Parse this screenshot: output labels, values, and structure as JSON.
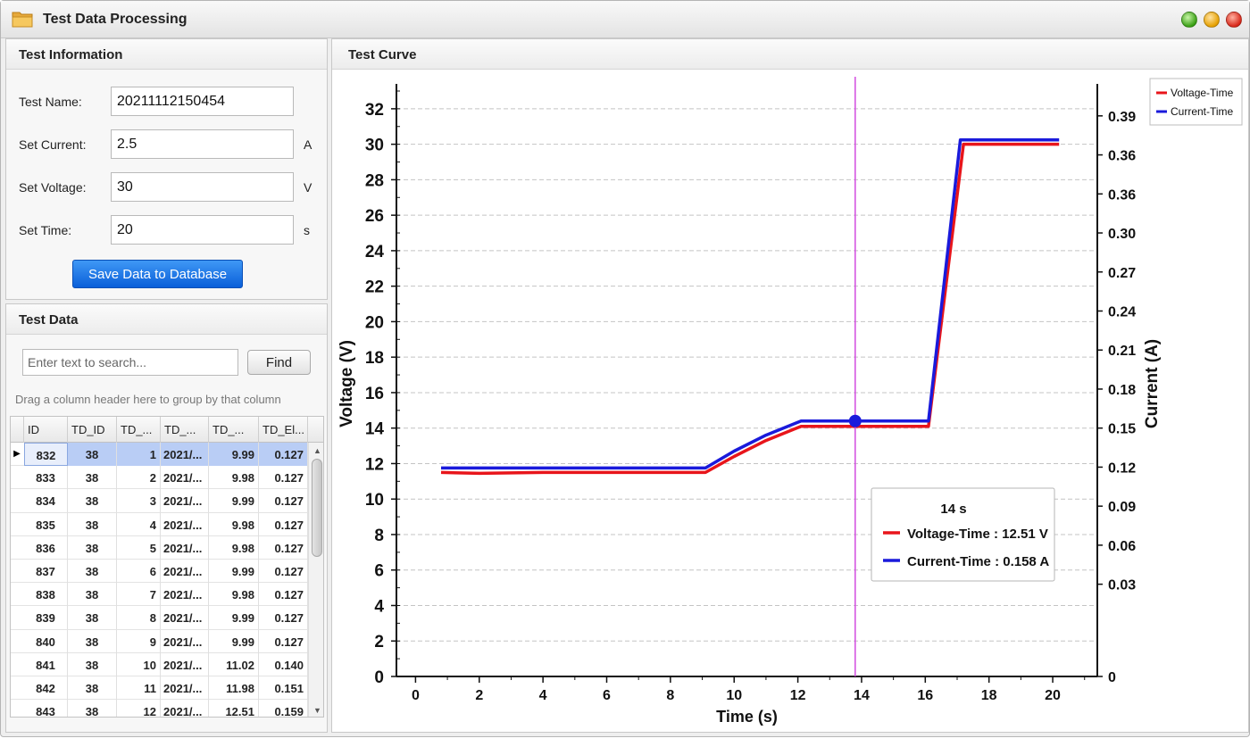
{
  "window": {
    "title": "Test Data Processing"
  },
  "info_panel": {
    "title": "Test Information",
    "fields": {
      "name": {
        "label": "Test Name:",
        "value": "20211112150454",
        "unit": ""
      },
      "current": {
        "label": "Set Current:",
        "value": "2.5",
        "unit": "A"
      },
      "voltage": {
        "label": "Set Voltage:",
        "value": "30",
        "unit": "V"
      },
      "time": {
        "label": "Set Time:",
        "value": "20",
        "unit": "s"
      }
    },
    "save_label": "Save Data to Database"
  },
  "data_panel": {
    "title": "Test Data",
    "search_placeholder": "Enter text to search...",
    "find_label": "Find",
    "group_hint": "Drag a column header here to group by that column",
    "columns": [
      "ID",
      "TD_ID",
      "TD_...",
      "TD_...",
      "TD_...",
      "TD_El..."
    ],
    "selected_indicator": "▶",
    "rows": [
      [
        "832",
        "38",
        "1",
        "2021/...",
        "9.99",
        "0.127"
      ],
      [
        "833",
        "38",
        "2",
        "2021/...",
        "9.98",
        "0.127"
      ],
      [
        "834",
        "38",
        "3",
        "2021/...",
        "9.99",
        "0.127"
      ],
      [
        "835",
        "38",
        "4",
        "2021/...",
        "9.98",
        "0.127"
      ],
      [
        "836",
        "38",
        "5",
        "2021/...",
        "9.98",
        "0.127"
      ],
      [
        "837",
        "38",
        "6",
        "2021/...",
        "9.99",
        "0.127"
      ],
      [
        "838",
        "38",
        "7",
        "2021/...",
        "9.98",
        "0.127"
      ],
      [
        "839",
        "38",
        "8",
        "2021/...",
        "9.99",
        "0.127"
      ],
      [
        "840",
        "38",
        "9",
        "2021/...",
        "9.99",
        "0.127"
      ],
      [
        "841",
        "38",
        "10",
        "2021/...",
        "11.02",
        "0.140"
      ],
      [
        "842",
        "38",
        "11",
        "2021/...",
        "11.98",
        "0.151"
      ],
      [
        "843",
        "38",
        "12",
        "2021/...",
        "12.51",
        "0.159"
      ]
    ]
  },
  "curve_panel": {
    "title": "Test Curve"
  },
  "chart_data": {
    "type": "line",
    "xlabel": "Time (s)",
    "ylabel": "Voltage (V)",
    "y2label": "Current (A)",
    "xlim": [
      -0.6,
      21.4
    ],
    "ylim": [
      0,
      33
    ],
    "x_ticks": [
      0,
      2,
      4,
      6,
      8,
      10,
      12,
      14,
      16,
      18,
      20
    ],
    "y_ticks": [
      0,
      2,
      4,
      6,
      8,
      10,
      12,
      14,
      16,
      18,
      20,
      22,
      24,
      26,
      28,
      30,
      32
    ],
    "y2_tick_labels": [
      {
        "label": "0",
        "at_voltage": 0
      },
      {
        "label": "0.03",
        "at_voltage": 5.2
      },
      {
        "label": "0.06",
        "at_voltage": 7.4
      },
      {
        "label": "0.09",
        "at_voltage": 9.6
      },
      {
        "label": "0.12",
        "at_voltage": 11.8
      },
      {
        "label": "0.15",
        "at_voltage": 14.0
      },
      {
        "label": "0.18",
        "at_voltage": 16.2
      },
      {
        "label": "0.21",
        "at_voltage": 18.4
      },
      {
        "label": "0.24",
        "at_voltage": 20.6
      },
      {
        "label": "0.27",
        "at_voltage": 22.8
      },
      {
        "label": "0.30",
        "at_voltage": 25.0
      },
      {
        "label": "0.36",
        "at_voltage": 27.2
      },
      {
        "label": "0.36",
        "at_voltage": 29.4
      },
      {
        "label": "0.39",
        "at_voltage": 31.6
      }
    ],
    "grid": true,
    "legend_position": "top-right",
    "series": [
      {
        "name": "Voltage-Time",
        "color": "#e8151b",
        "x": [
          0.8,
          2,
          4,
          6,
          8,
          9.1,
          10,
          11,
          12.1,
          14,
          16.1,
          17.2,
          20.2
        ],
        "y": [
          11.5,
          11.45,
          11.5,
          11.5,
          11.5,
          11.5,
          12.4,
          13.3,
          14.1,
          14.1,
          14.1,
          30.0,
          30.0
        ]
      },
      {
        "name": "Current-Time",
        "color": "#1a1adb",
        "x": [
          0.8,
          2,
          4,
          6,
          8,
          9.1,
          10,
          11,
          12.1,
          14,
          16.1,
          17.1,
          20.2
        ],
        "y": [
          11.75,
          11.75,
          11.75,
          11.75,
          11.75,
          11.75,
          12.7,
          13.6,
          14.4,
          14.4,
          14.4,
          30.25,
          30.25
        ]
      }
    ],
    "cursor": {
      "x": 13.8,
      "marker_y": 14.4,
      "color": "#d24be0"
    },
    "tooltip": {
      "title": "14 s",
      "items": [
        {
          "label": "Voltage-Time : 12.51 V",
          "color": "#e8151b"
        },
        {
          "label": "Current-Time : 0.158 A",
          "color": "#1a1adb"
        }
      ]
    }
  }
}
